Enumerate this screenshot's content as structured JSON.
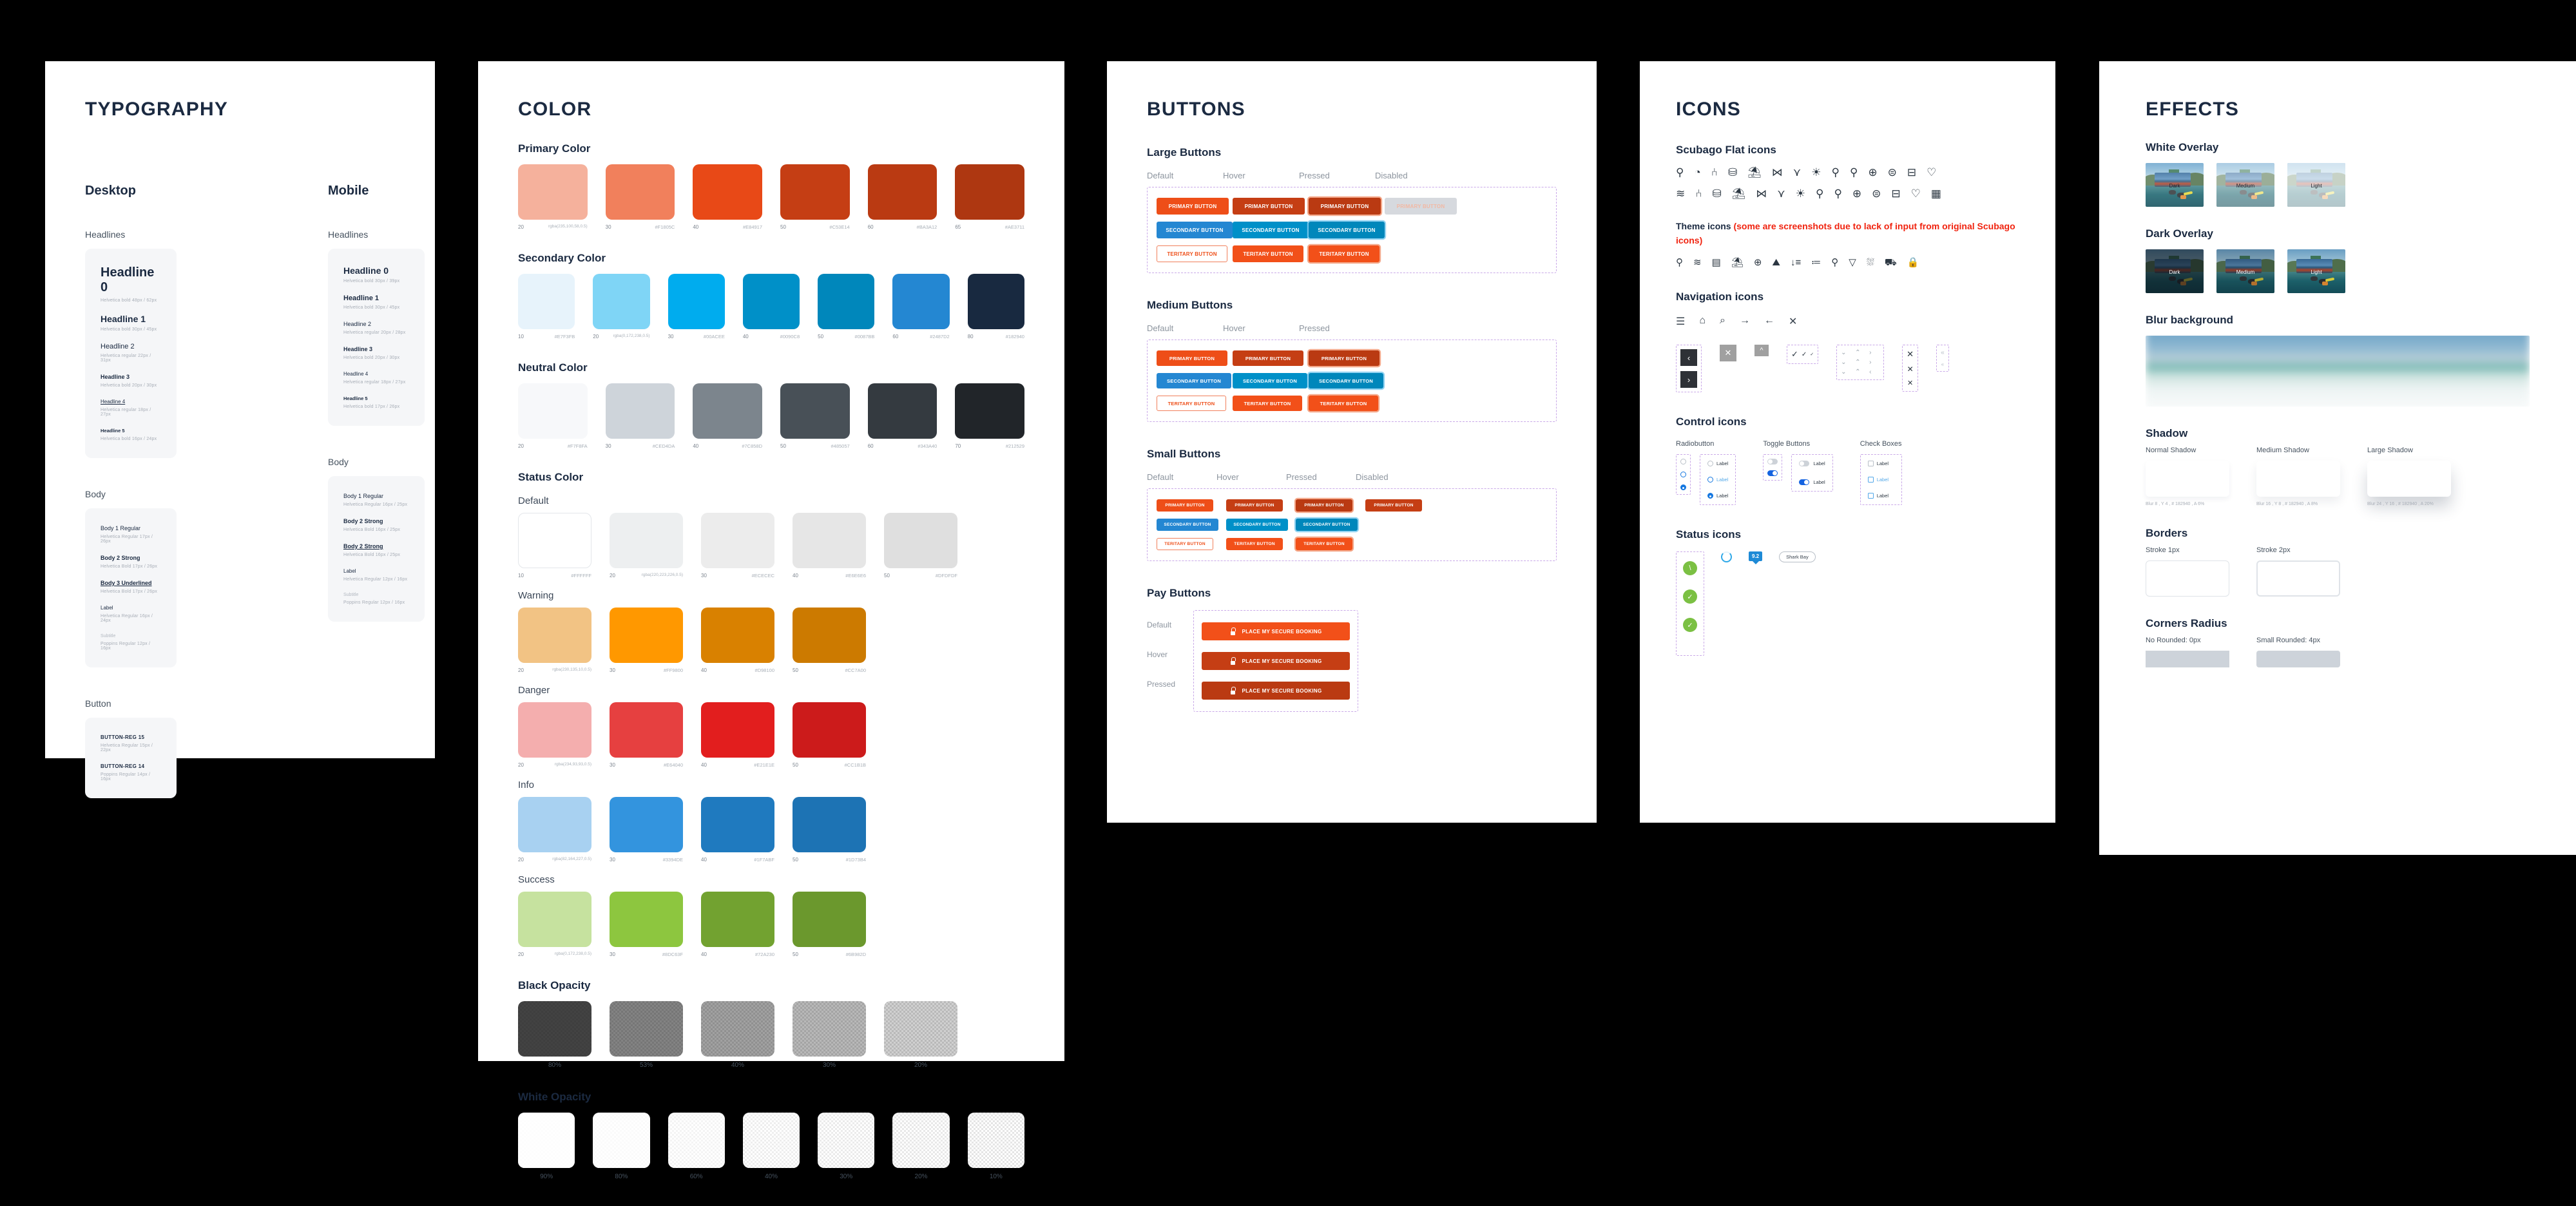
{
  "typography": {
    "title": "TYPOGRAPHY",
    "columns": [
      {
        "name": "Desktop",
        "groups": [
          {
            "label": "Headlines",
            "items": [
              {
                "sample": "Headline 0",
                "spec": "Helvetica bold   48px / 62px"
              },
              {
                "sample": "Headline 1",
                "spec": "Helvetica bold   30px / 45px"
              },
              {
                "sample": "Headline 2",
                "spec": "Helvetica regular   22px / 31px"
              },
              {
                "sample": "Headline 3",
                "spec": "Helvetica bold   20px / 30px"
              },
              {
                "sample": "Headline 4",
                "spec": "Helvetica regular   18px / 27px"
              },
              {
                "sample": "Headline 5",
                "spec": "Helvetica bold   16px / 24px"
              }
            ]
          },
          {
            "label": "Body",
            "items": [
              {
                "sample": "Body 1 Regular",
                "spec": "Helvetica Regular   17px / 26px"
              },
              {
                "sample": "Body 2 Strong",
                "spec": "Helvetica Bold   17px / 26px"
              },
              {
                "sample": "Body 3 Underlined",
                "spec": "Helvetica Bold   17px / 26px"
              },
              {
                "sample": "Label",
                "spec": "Helvetica Regular   16px / 24px"
              },
              {
                "sample": "Subtitle",
                "spec": "Poppins Regular   12px / 16px"
              }
            ]
          },
          {
            "label": "Button",
            "items": [
              {
                "sample": "BUTTON-REG 15",
                "spec": "Helvetica Regular   15px / 22px"
              },
              {
                "sample": "BUTTON-REG 14",
                "spec": "Poppins Regular   14px / 16px"
              }
            ]
          }
        ]
      },
      {
        "name": "Mobile",
        "groups": [
          {
            "label": "Headlines",
            "items": [
              {
                "sample": "Headline 0",
                "spec": "Helvetica bold   30px / 39px"
              },
              {
                "sample": "Headline 1",
                "spec": "Helvetica bold   30px / 45px"
              },
              {
                "sample": "Headline 2",
                "spec": "Helvetica regular   20px / 28px"
              },
              {
                "sample": "Headline 3",
                "spec": "Helvetica bold   20px / 30px"
              },
              {
                "sample": "Headline 4",
                "spec": "Helvetica regular   18px / 27px"
              },
              {
                "sample": "Headline 5",
                "spec": "Helvetica bold   17px / 26px"
              }
            ]
          },
          {
            "label": "Body",
            "items": [
              {
                "sample": "Body 1 Regular",
                "spec": "Helvetica Regular   16px / 25px"
              },
              {
                "sample": "Body 2 Strong",
                "spec": "Helvetica Bold   16px / 25px"
              },
              {
                "sample": "Body 2 Strong",
                "spec": "Helvetica Bold   16px / 25px"
              },
              {
                "sample": "Label",
                "spec": "Helvetica Regular   12px / 16px"
              },
              {
                "sample": "Subtitle",
                "spec": "Poppins Regular   12px / 16px"
              }
            ]
          }
        ]
      }
    ]
  },
  "color": {
    "title": "COLOR",
    "sections": [
      {
        "name": "Primary Color",
        "kind": "main",
        "swatches": [
          {
            "num": "20",
            "hex": "rgba(235,100,58,0.5)",
            "css": "rgba(235,100,58,0.5)"
          },
          {
            "num": "30",
            "hex": "#F1805C",
            "css": "#F1805C"
          },
          {
            "num": "40",
            "hex": "#E84917",
            "css": "#E84917"
          },
          {
            "num": "50",
            "hex": "#C53E14",
            "css": "#C53E14"
          },
          {
            "num": "60",
            "hex": "#BA3A12",
            "css": "#BA3A12"
          },
          {
            "num": "65",
            "hex": "#AE3711",
            "css": "#AE3711"
          }
        ]
      },
      {
        "name": "Secondary Color",
        "kind": "main",
        "swatches": [
          {
            "num": "10",
            "hex": "#E7F3FB",
            "css": "#E7F3FB"
          },
          {
            "num": "20",
            "hex": "rgba(0,172,238,0.5)",
            "css": "rgba(0,172,238,0.5)"
          },
          {
            "num": "30",
            "hex": "#00ACEE",
            "css": "#00ACEE"
          },
          {
            "num": "40",
            "hex": "#0090C8",
            "css": "#0090C8"
          },
          {
            "num": "50",
            "hex": "#0087BB",
            "css": "#0087BB"
          },
          {
            "num": "60",
            "hex": "#2487D2",
            "css": "#2487D2"
          },
          {
            "num": "80",
            "hex": "#182940",
            "css": "#182940"
          }
        ]
      },
      {
        "name": "Neutral Color",
        "kind": "main",
        "swatches": [
          {
            "num": "20",
            "hex": "#F7F8FA",
            "css": "#F7F8FA"
          },
          {
            "num": "30",
            "hex": "#CED4DA",
            "css": "#CED4DA"
          },
          {
            "num": "40",
            "hex": "#7C858D",
            "css": "#7C858D"
          },
          {
            "num": "50",
            "hex": "#485057",
            "css": "#485057"
          },
          {
            "num": "60",
            "hex": "#343A40",
            "css": "#343A40"
          },
          {
            "num": "70",
            "hex": "#212529",
            "css": "#212529"
          }
        ]
      }
    ],
    "status_title": "Status Color",
    "status": [
      {
        "name": "Default",
        "swatches": [
          {
            "num": "10",
            "hex": "#FFFFFF",
            "css": "#FFFFFF"
          },
          {
            "num": "20",
            "hex": "rgba(220,223,226,0.5)",
            "css": "rgba(220,223,226,0.5)"
          },
          {
            "num": "30",
            "hex": "#ECECEC",
            "css": "#ECECEC"
          },
          {
            "num": "40",
            "hex": "#E6E6E6",
            "css": "#E6E6E6"
          },
          {
            "num": "50",
            "hex": "#DFDFDF",
            "css": "#DFDFDF"
          }
        ]
      },
      {
        "name": "Warning",
        "swatches": [
          {
            "num": "20",
            "hex": "rgba(230,135,10,0.5)",
            "css": "rgba(230,135,10,0.5)"
          },
          {
            "num": "30",
            "hex": "#FF9800",
            "css": "#FF9800"
          },
          {
            "num": "40",
            "hex": "#D98100",
            "css": "#D98100"
          },
          {
            "num": "50",
            "hex": "#CC7A00",
            "css": "#CC7A00"
          }
        ]
      },
      {
        "name": "Danger",
        "swatches": [
          {
            "num": "20",
            "hex": "rgba(234,93,93,0.5)",
            "css": "rgba(234,93,93,0.5)"
          },
          {
            "num": "30",
            "hex": "#E64040",
            "css": "#E64040"
          },
          {
            "num": "40",
            "hex": "#E21E1E",
            "css": "#E21E1E"
          },
          {
            "num": "50",
            "hex": "#CC1B1B",
            "css": "#CC1B1B"
          }
        ]
      },
      {
        "name": "Info",
        "swatches": [
          {
            "num": "20",
            "hex": "rgba(82,164,227,0.5)",
            "css": "rgba(82,164,227,0.5)"
          },
          {
            "num": "30",
            "hex": "#3394DE",
            "css": "#3394DE"
          },
          {
            "num": "40",
            "hex": "#1F7ABF",
            "css": "#1F7ABF"
          },
          {
            "num": "50",
            "hex": "#1D73B4",
            "css": "#1D73B4"
          }
        ]
      },
      {
        "name": "Success",
        "swatches": [
          {
            "num": "20",
            "hex": "rgba(0,172,238,0.5)",
            "css": "rgba(141,198,63,0.5)"
          },
          {
            "num": "30",
            "hex": "#8DC63F",
            "css": "#8DC63F"
          },
          {
            "num": "40",
            "hex": "#72A230",
            "css": "#72A230"
          },
          {
            "num": "50",
            "hex": "#6B982D",
            "css": "#6B982D"
          }
        ]
      }
    ],
    "black_opacity": {
      "name": "Black Opacity",
      "steps": [
        "80%",
        "53%",
        "40%",
        "30%",
        "20%"
      ],
      "values": [
        0.8,
        0.53,
        0.4,
        0.3,
        0.2
      ]
    },
    "white_opacity": {
      "name": "White Opacity",
      "steps": [
        "90%",
        "80%",
        "60%",
        "40%",
        "30%",
        "20%",
        "10%"
      ],
      "values": [
        0.9,
        0.8,
        0.6,
        0.4,
        0.3,
        0.2,
        0.1
      ]
    }
  },
  "buttons": {
    "title": "BUTTONS",
    "labels": {
      "primary": "PRIMARY BUTTON",
      "secondary": "SECONDARY BUTTON",
      "tertiary": "TERITARY BUTTON"
    },
    "groups": [
      {
        "name": "Large Buttons",
        "states": [
          "Default",
          "Hover",
          "Pressed",
          "Disabled"
        ],
        "has_disabled": true
      },
      {
        "name": "Medium Buttons",
        "states": [
          "Default",
          "Hover",
          "Pressed"
        ],
        "has_disabled": false
      },
      {
        "name": "Small Buttons",
        "states": [
          "Default",
          "Hover",
          "Pressed",
          "Disabled"
        ],
        "has_disabled": true
      }
    ],
    "pay": {
      "name": "Pay Buttons",
      "label": "PLACE MY SECURE BOOKING",
      "rows": [
        {
          "state": "Default",
          "bg": "#F25019"
        },
        {
          "state": "Hover",
          "bg": "#C53E14"
        },
        {
          "state": "Pressed",
          "bg": "#BA3A12"
        }
      ]
    },
    "colors": {
      "primary_default": "#EE4E18",
      "primary_hover": "#C53E14",
      "primary_pressed": "#BA3A12",
      "primary_disabled_bg": "#D6D9DE",
      "primary_disabled_text": "#F2B8A3",
      "secondary_default": "#2487D2",
      "secondary_hover": "#0090C8",
      "secondary_pressed": "#0087BB",
      "tertiary_border": "#F1805C",
      "tertiary_text": "#EE4E18",
      "tertiary_hover": "#F25019",
      "tertiary_pressed": "#F25019"
    }
  },
  "icons": {
    "title": "ICONS",
    "flat": {
      "name": "Scubago Flat icons",
      "row1": [
        "snorkel-icon",
        "diving-tank-icon",
        "fins-icon",
        "bag-icon",
        "bed-icon",
        "fish-icon",
        "whale-tail-icon",
        "sunrise-icon",
        "pin-icon",
        "pin-drop-icon",
        "pin-globe-icon",
        "pin-chat-icon",
        "pin-card-icon",
        "pin-heart-icon"
      ],
      "row1_glyphs": [
        "⚲",
        "◔",
        "⑃",
        "⛁",
        "⛱",
        "⋈",
        "⋎",
        "☀",
        "⚲",
        "⚲",
        "⊕",
        "⊜",
        "⊟",
        "♡"
      ],
      "row2": [
        "waves-icon",
        "fins-icon",
        "bag-icon",
        "bed-icon",
        "fish-icon",
        "whale-tail-icon",
        "sunrise-icon",
        "pin-icon",
        "pin-drop-icon",
        "pin-globe-icon",
        "pin-chat-icon",
        "pin-card-icon",
        "pin-heart-icon",
        "calendar-icon"
      ],
      "row2_glyphs": [
        "≋",
        "⑃",
        "⛁",
        "⛱",
        "⋈",
        "⋎",
        "☀",
        "⚲",
        "⚲",
        "⊕",
        "⊜",
        "⊟",
        "♡",
        "▦"
      ]
    },
    "theme": {
      "label": "Theme icons ",
      "note": "(some are screenshots due to lack of input from original Scubago icons)",
      "glyphs": [
        "⚲",
        "≋",
        "▤",
        "⛱",
        "⊕",
        "⛰",
        "↓≡",
        "≔",
        "⚲",
        "▽",
        "⛆",
        "⛟",
        "🔒"
      ],
      "names": [
        "diver-icon",
        "waves-icon",
        "calendar-icon",
        "bed-icon",
        "globe-icon",
        "map-icon",
        "sort-icon",
        "filter-icon",
        "location-icon",
        "funnel-icon",
        "boat-icon",
        "bus-icon",
        "lock-icon"
      ]
    },
    "navigation": {
      "name": "Navigation icons",
      "glyphs": [
        "☰",
        "⌂",
        "⌕",
        "→",
        "←",
        "✕"
      ],
      "names": [
        "hamburger-icon",
        "home-icon",
        "search-icon",
        "arrow-right-icon",
        "arrow-left-icon",
        "close-icon"
      ],
      "prev": "‹",
      "next": "›",
      "big_close": "✕",
      "chevron_up": "^",
      "checks": [
        "✓",
        "✓",
        "✓"
      ],
      "arrow_grid": [
        "⌄",
        "⌃",
        "›",
        "⌄",
        "⌃",
        "›",
        "⌄",
        "⌃",
        "‹"
      ],
      "x_column": [
        "✕",
        "✕",
        "✕"
      ],
      "double_chevrons": [
        "«",
        "«"
      ]
    },
    "control": {
      "name": "Control icons",
      "columns": [
        {
          "name": "Radiobutton",
          "label": "Label"
        },
        {
          "name": "Toggle Buttons",
          "label": "Label"
        },
        {
          "name": "Check Boxes",
          "label": "Label"
        }
      ]
    },
    "status": {
      "name": "Status icons",
      "badge": "9.2",
      "chip": "Shark Bay",
      "checks": [
        "\\",
        "✓",
        "✓"
      ]
    }
  },
  "effects": {
    "title": "EFFECTS",
    "white_overlay": {
      "name": "White Overlay",
      "items": [
        {
          "caption": "Dark",
          "alpha": 0.12,
          "color": "#ffffff",
          "text": "#20262c"
        },
        {
          "caption": "Medium",
          "alpha": 0.42,
          "color": "#ffffff",
          "text": "#20262c"
        },
        {
          "caption": "Light",
          "alpha": 0.68,
          "color": "#ffffff",
          "text": "#20262c"
        }
      ]
    },
    "dark_overlay": {
      "name": "Dark Overlay",
      "items": [
        {
          "caption": "Dark",
          "alpha": 0.62,
          "color": "#0c1218",
          "text": "#ffffff"
        },
        {
          "caption": "Medium",
          "alpha": 0.22,
          "color": "#0c1218",
          "text": "#ffffff"
        },
        {
          "caption": "Light",
          "alpha": 0.06,
          "color": "#0c1218",
          "text": "#ffffff"
        }
      ]
    },
    "blur": {
      "name": "Blur background"
    },
    "shadow": {
      "name": "Shadow",
      "items": [
        {
          "label": "Normal Shadow",
          "spec": "Blur 8  , Y 4  , # 182940  , A 6%"
        },
        {
          "label": "Medium Shadow",
          "spec": "Blur 16  , Y 8  , # 182940  , A 8%"
        },
        {
          "label": "Large Shadow",
          "spec": "Blur 24  , Y 16  , # 182940  , A 20%"
        }
      ]
    },
    "borders": {
      "name": "Borders",
      "items": [
        {
          "label": "Stroke 1px"
        },
        {
          "label": "Stroke 2px"
        }
      ]
    },
    "corners": {
      "name": "Corners Radius",
      "items": [
        {
          "label": "No Rounded: 0px"
        },
        {
          "label": "Small Rounded: 4px"
        }
      ]
    }
  }
}
